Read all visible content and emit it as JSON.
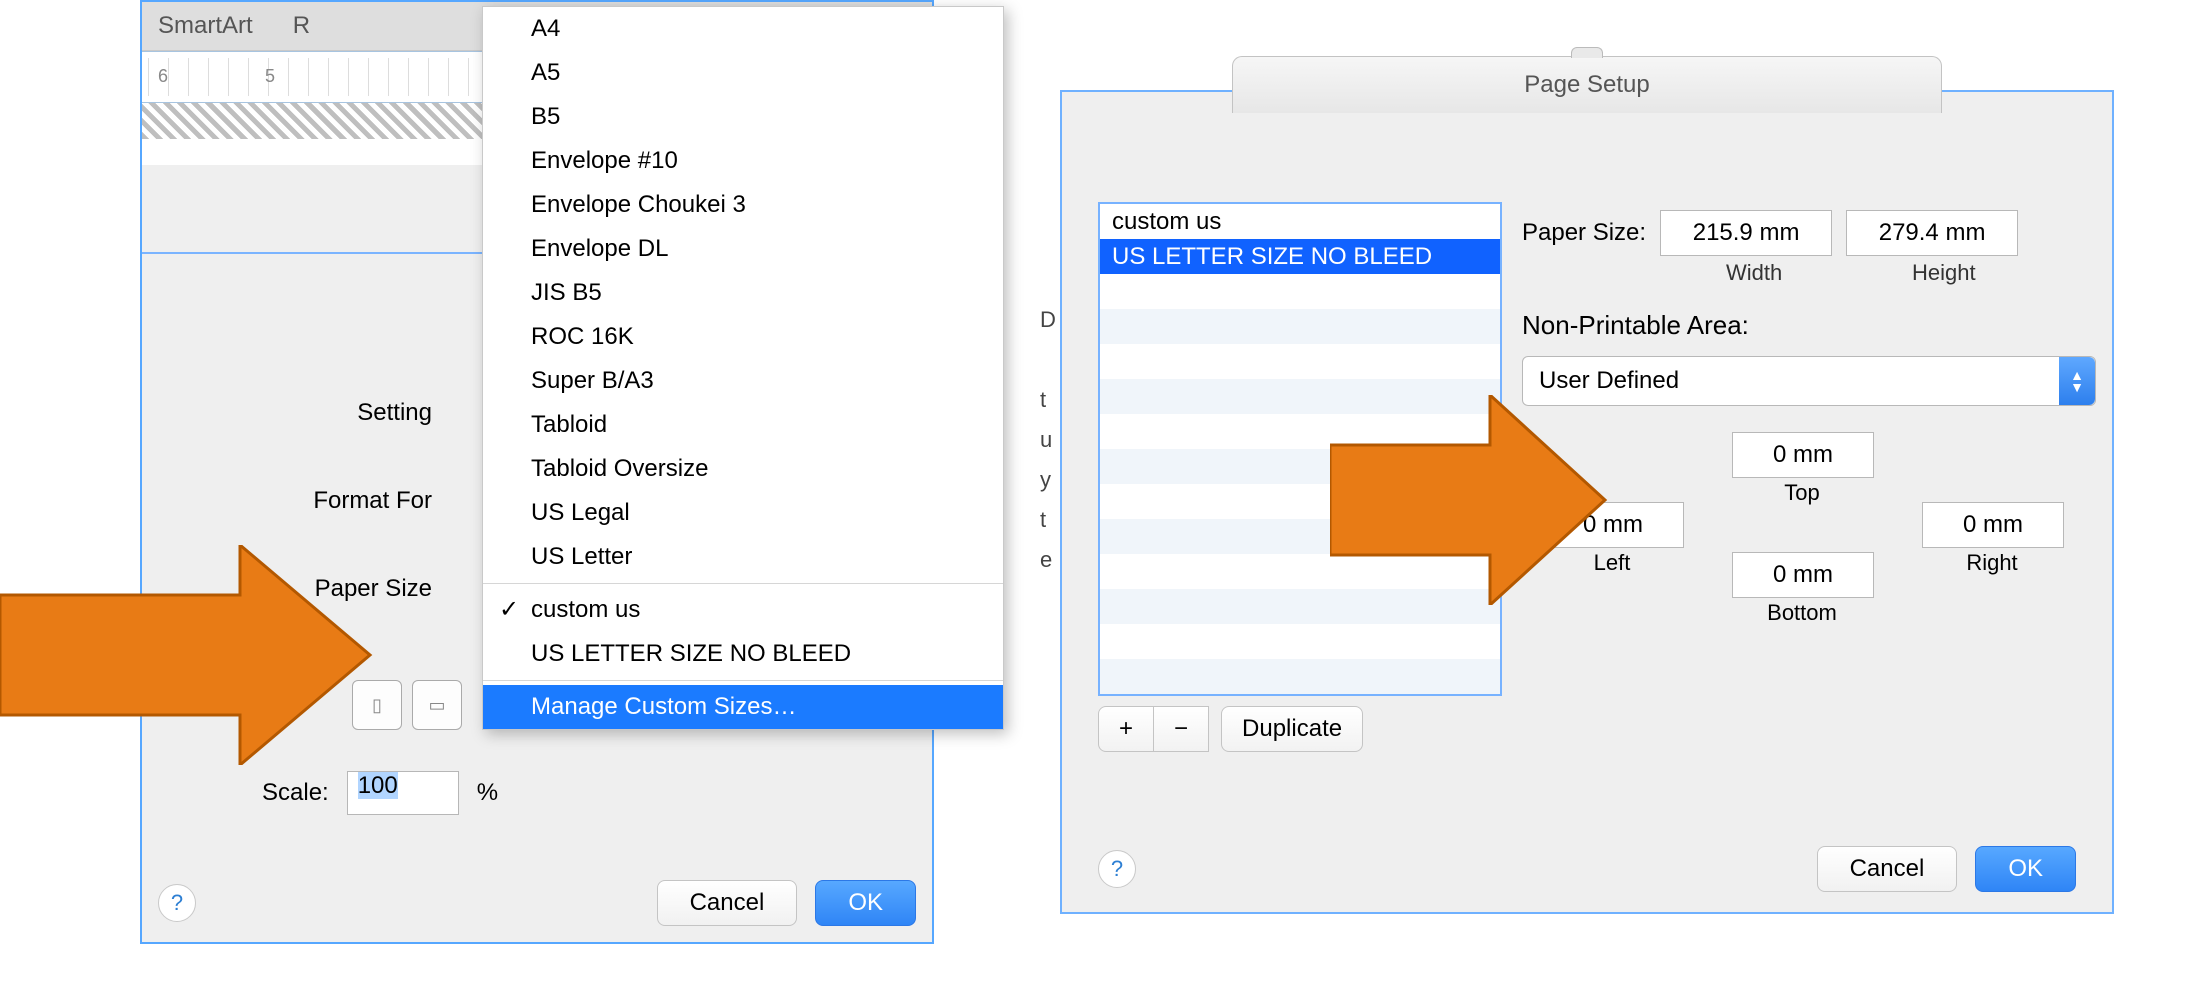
{
  "left": {
    "tabs": [
      "SmartArt",
      "R"
    ],
    "ruler_numbers": "6 5",
    "labels": {
      "settings": "Setting",
      "format_for": "Format For",
      "paper_size": "Paper Size",
      "scale": "Scale:",
      "percent": "%"
    },
    "scale_value": "100",
    "dropdown": {
      "standard": [
        "A4",
        "A5",
        "B5",
        "Envelope #10",
        "Envelope Choukei 3",
        "Envelope DL",
        "JIS B5",
        "ROC 16K",
        "Super B/A3",
        "Tabloid",
        "Tabloid Oversize",
        "US Legal",
        "US Letter"
      ],
      "custom": [
        {
          "label": "custom us",
          "checked": true
        },
        {
          "label": "US LETTER SIZE NO BLEED",
          "checked": false
        }
      ],
      "manage": "Manage Custom Sizes…"
    },
    "buttons": {
      "cancel": "Cancel",
      "ok": "OK"
    }
  },
  "right": {
    "title": "Page Setup",
    "list": [
      {
        "label": "custom us",
        "selected": false
      },
      {
        "label": "US LETTER SIZE NO BLEED",
        "selected": true
      }
    ],
    "list_buttons": {
      "plus": "+",
      "minus": "−",
      "duplicate": "Duplicate"
    },
    "paper_size": {
      "label": "Paper Size:",
      "width": "215.9 mm",
      "width_sub": "Width",
      "height": "279.4 mm",
      "height_sub": "Height"
    },
    "npa": {
      "label": "Non-Printable Area:",
      "select": "User Defined"
    },
    "margins": {
      "top": "0 mm",
      "top_label": "Top",
      "left": "0 mm",
      "left_label": "Left",
      "right": "0 mm",
      "right_label": "Right",
      "bottom": "0 mm",
      "bottom_label": "Bottom"
    },
    "buttons": {
      "cancel": "Cancel",
      "ok": "OK"
    }
  }
}
